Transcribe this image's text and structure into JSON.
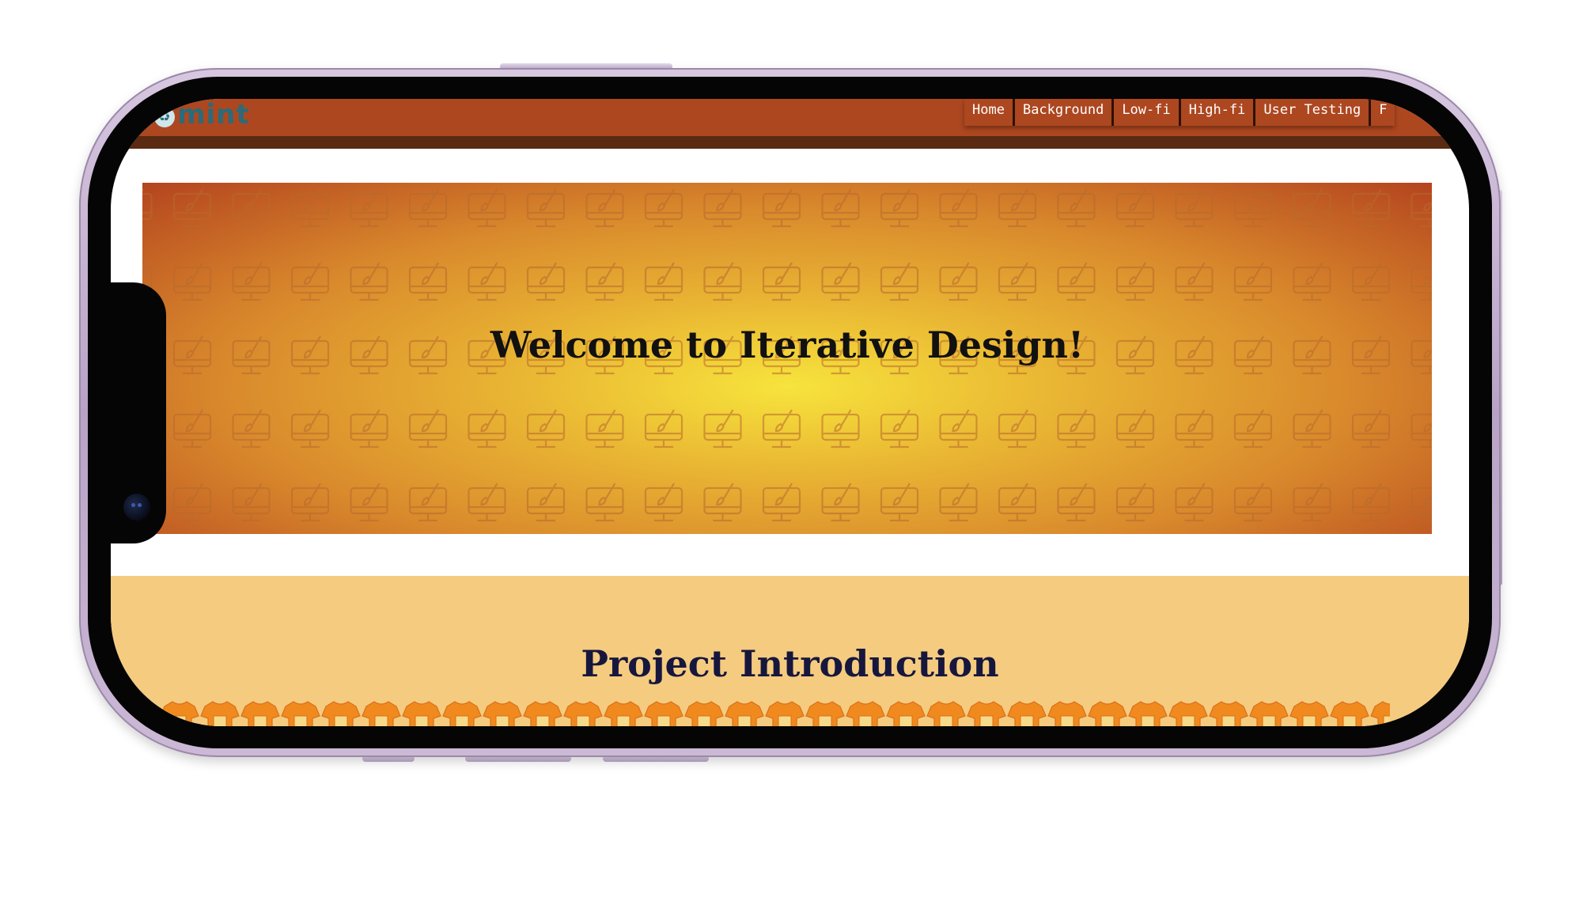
{
  "logo": {
    "text_before": "e",
    "text_after": "mint",
    "icon": "recycle-icon"
  },
  "nav": {
    "items": [
      "Home",
      "Background",
      "Low-fi",
      "High-fi",
      "User Testing",
      "F"
    ]
  },
  "hero": {
    "title": "Welcome to Iterative Design!",
    "pattern_icon": "monitor-paintbrush-icon"
  },
  "intro": {
    "title": "Project Introduction",
    "decoration_icon": "tshirt-icon"
  },
  "colors": {
    "header": "#ad4720",
    "header_band": "#5a2a12",
    "hero_center": "#f7e43c",
    "hero_edge": "#b4441f",
    "intro_bg": "#f5cb7f",
    "shirt": "#f08a1e",
    "phone_frame": "#c9b6d6"
  }
}
